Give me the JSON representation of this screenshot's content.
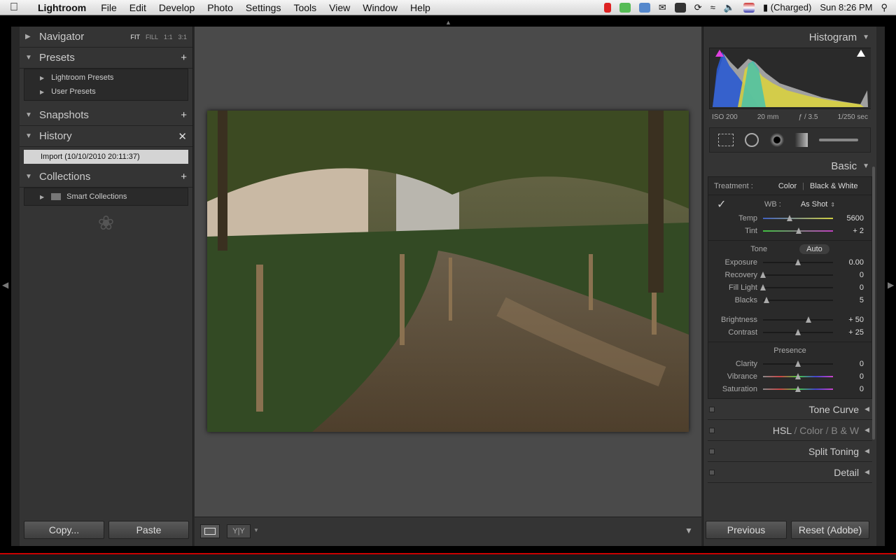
{
  "menubar": {
    "app_name": "Lightroom",
    "items": [
      "File",
      "Edit",
      "Develop",
      "Photo",
      "Settings",
      "Tools",
      "View",
      "Window",
      "Help"
    ],
    "battery": "(Charged)",
    "clock": "Sun 8:26 PM"
  },
  "left": {
    "navigator": {
      "label": "Navigator",
      "modes": [
        "FIT",
        "FILL",
        "1:1",
        "3:1"
      ]
    },
    "presets": {
      "label": "Presets",
      "items": [
        "Lightroom Presets",
        "User Presets"
      ]
    },
    "snapshots": {
      "label": "Snapshots"
    },
    "history": {
      "label": "History",
      "items": [
        "Import (10/10/2010 20:11:37)"
      ]
    },
    "collections": {
      "label": "Collections",
      "items": [
        "Smart Collections"
      ]
    },
    "copy_label": "Copy...",
    "paste_label": "Paste"
  },
  "right": {
    "histogram_label": "Histogram",
    "exif": {
      "iso": "ISO 200",
      "focal": "20 mm",
      "aperture": "ƒ / 3.5",
      "shutter": "1/250 sec"
    },
    "basic_label": "Basic",
    "treatment_label": "Treatment :",
    "treatment_color": "Color",
    "treatment_bw": "Black & White",
    "wb_label": "WB :",
    "wb_value": "As Shot",
    "tone_label": "Tone",
    "auto_label": "Auto",
    "presence_label": "Presence",
    "sliders": {
      "temp": {
        "label": "Temp",
        "value": "5600",
        "level": 0.38
      },
      "tint": {
        "label": "Tint",
        "value": "+ 2",
        "level": 0.51
      },
      "exposure": {
        "label": "Exposure",
        "value": "0.00",
        "level": 0.5
      },
      "recovery": {
        "label": "Recovery",
        "value": "0",
        "level": 0.0
      },
      "fill_light": {
        "label": "Fill Light",
        "value": "0",
        "level": 0.0
      },
      "blacks": {
        "label": "Blacks",
        "value": "5",
        "level": 0.05
      },
      "brightness": {
        "label": "Brightness",
        "value": "+ 50",
        "level": 0.65
      },
      "contrast": {
        "label": "Contrast",
        "value": "+ 25",
        "level": 0.5
      },
      "clarity": {
        "label": "Clarity",
        "value": "0",
        "level": 0.5
      },
      "vibrance": {
        "label": "Vibrance",
        "value": "0",
        "level": 0.5
      },
      "saturation": {
        "label": "Saturation",
        "value": "0",
        "level": 0.5
      }
    },
    "tone_curve_label": "Tone Curve",
    "hsl_label": "HSL",
    "hsl_color_label": "Color",
    "hsl_bw_label": "B & W",
    "hsl_sep": "/",
    "split_toning_label": "Split Toning",
    "detail_label": "Detail",
    "previous_label": "Previous",
    "reset_label": "Reset (Adobe)"
  }
}
